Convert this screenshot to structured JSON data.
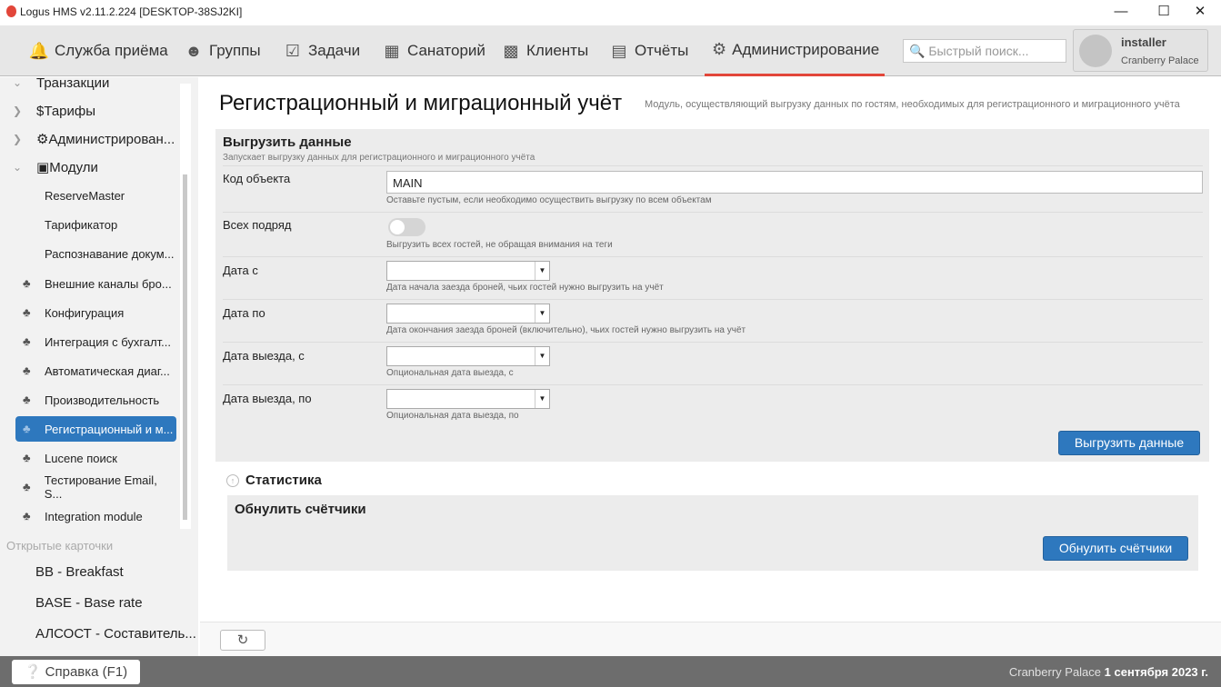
{
  "window": {
    "title": "Logus HMS v2.11.2.224 [DESKTOP-38SJ2KI]"
  },
  "nav": {
    "items": [
      {
        "label": "Служба приёма",
        "icon": "bell-icon"
      },
      {
        "label": "Группы",
        "icon": "users-icon"
      },
      {
        "label": "Задачи",
        "icon": "calendar-check-icon"
      },
      {
        "label": "Санаторий",
        "icon": "building-icon"
      },
      {
        "label": "Клиенты",
        "icon": "briefcase-icon"
      },
      {
        "label": "Отчёты",
        "icon": "bar-chart-icon"
      },
      {
        "label": "Администрирование",
        "icon": "gears-icon"
      }
    ],
    "search_placeholder": "Быстрый поиск...",
    "user": {
      "name": "installer",
      "property": "Cranberry Palace"
    }
  },
  "sidebar": {
    "tree": [
      "Транзакции",
      "Тарифы",
      "Администрирован...",
      "Модули"
    ],
    "sub": [
      "ReserveMaster",
      "Тарификатор",
      "Распознавание докум..."
    ],
    "items": [
      "Внешние каналы бро...",
      "Конфигурация",
      "Интеграция с бухгалт...",
      "Автоматическая диаг...",
      "Производительность",
      "Регистрационный и м...",
      "Lucene поиск",
      "Тестирование Email, S...",
      "Integration module"
    ],
    "open_cards_label": "Открытые карточки",
    "cards": [
      "BB - Breakfast",
      "BASE - Base rate",
      "АЛСОСТ - Составитель..."
    ]
  },
  "main": {
    "title": "Регистрационный и миграционный учёт",
    "description": "Модуль, осуществляющий выгрузку данных по гостям, необходимых для регистрационного и миграционного учёта",
    "export": {
      "title": "Выгрузить данные",
      "subtitle": "Запускает выгрузку данных для регистрационного и миграционного учёта",
      "object_code": {
        "label": "Код объекта",
        "value": "MAIN",
        "hint": "Оставьте пустым, если необходимо осуществить выгрузку по всем объектам"
      },
      "all": {
        "label": "Всех подряд",
        "value": false,
        "hint": "Выгрузить всех гостей, не обращая внимания на теги"
      },
      "date_from": {
        "label": "Дата с",
        "value": "",
        "hint": "Дата начала заезда броней, чьих гостей нужно выгрузить на учёт"
      },
      "date_to": {
        "label": "Дата по",
        "value": "",
        "hint": "Дата окончания заезда броней (включительно), чьих гостей нужно выгрузить на учёт"
      },
      "checkout_from": {
        "label": "Дата выезда, с",
        "value": "",
        "hint": "Опциональная дата выезда, с"
      },
      "checkout_to": {
        "label": "Дата выезда, по",
        "value": "",
        "hint": "Опциональная дата выезда, по"
      },
      "button": "Выгрузить данные"
    },
    "stats": {
      "title": "Статистика",
      "reset_title": "Обнулить счётчики",
      "reset_button": "Обнулить счётчики"
    }
  },
  "footer": {
    "help": "Справка (F1)",
    "property": "Cranberry Palace",
    "date": "1 сентября 2023 г."
  }
}
